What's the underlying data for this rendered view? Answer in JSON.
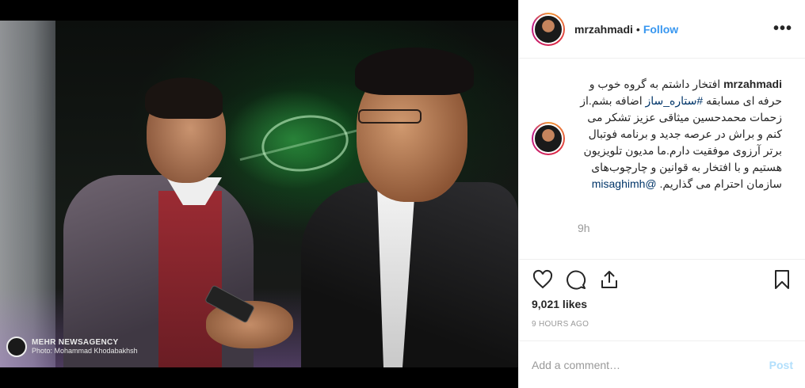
{
  "header": {
    "username": "mrzahmadi",
    "separator": "•",
    "follow_label": "Follow",
    "more_icon": "more-horizontal-icon"
  },
  "photo": {
    "watermark_brand": "MEHR NEWSAGENCY",
    "watermark_credit": "Photo: Mohammad Khodabakhsh"
  },
  "caption": {
    "username": "mrzahmadi",
    "text_part1": "افتخار داشتم به گروه خوب و حرفه ای مسابقه ",
    "hashtag": "#ستاره_ساز",
    "text_part2": " اضافه بشم.از زحمات محمدحسین میثاقی عزیز تشکر می کنم و براش در عرصه جدید و برنامه فوتبال برتر آرزوی موفقیت دارم.ما مدیون تلویزیون هستیم و با افتخار به قوانین و چارچوب‌های سازمان احترام می گذاریم. ",
    "mention": "@misaghimh",
    "time_ago": "9h"
  },
  "actions": {
    "like_icon": "heart-icon",
    "comment_icon": "comment-icon",
    "share_icon": "share-icon",
    "save_icon": "bookmark-icon"
  },
  "stats": {
    "likes": "9,021 likes",
    "posted": "9 HOURS AGO"
  },
  "comment_box": {
    "placeholder": "Add a comment…",
    "post_label": "Post"
  },
  "colors": {
    "link_blue": "#3897f0",
    "post_disabled": "#b2dffc",
    "muted": "#999999"
  }
}
